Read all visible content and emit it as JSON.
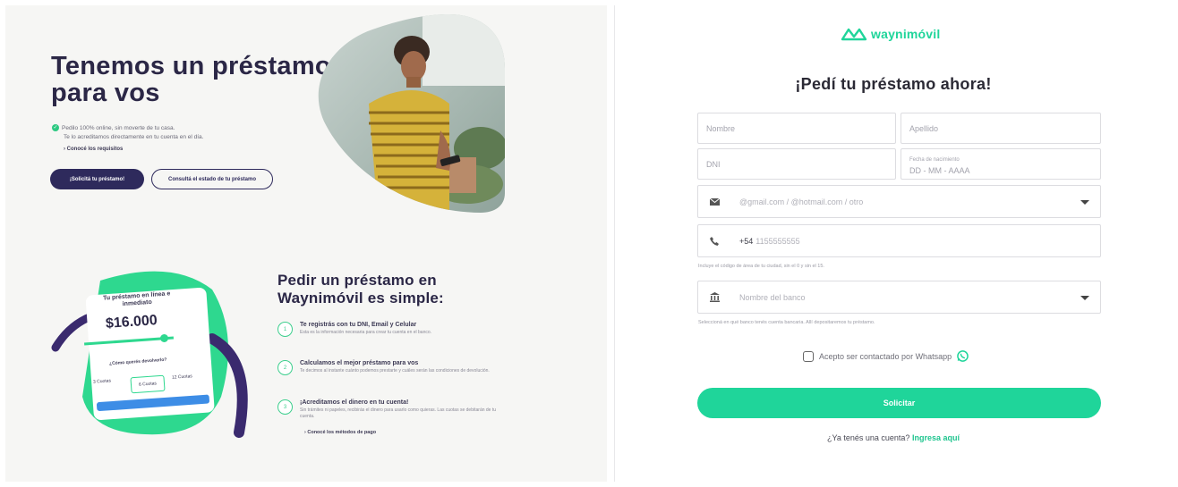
{
  "hero": {
    "title": "Tenemos un préstamo para vos",
    "bullet_1": "Pedilo 100% online, sin moverte de tu casa.",
    "bullet_2": "Te lo acreditamos directamente en tu cuenta en el día.",
    "requirements_link": "› Conocé los requisitos",
    "primary_button": "¡Solicitá tu préstamo!",
    "secondary_button": "Consultá el estado de tu préstamo"
  },
  "loan_card": {
    "heading": "Tu préstamo en línea e inmediato",
    "amount": "$16.000",
    "question": "¿Cómo querés devolverlo?",
    "options": [
      "3 Cuotas",
      "6 Cuotas",
      "12 Cuotas"
    ]
  },
  "steps": {
    "title": "Pedir un préstamo en Waynimóvil es simple:",
    "items": [
      {
        "num": "1",
        "title": "Te registrás con tu DNI, Email y Celular",
        "desc": "Esta es la información necesaria para crear tu cuenta en el banco."
      },
      {
        "num": "2",
        "title": "Calculamos el mejor préstamo para vos",
        "desc": "Te decimos al instante cuánto podemos prestarte y cuáles serán las condiciones de devolución."
      },
      {
        "num": "3",
        "title": "¡Acreditamos el dinero en tu cuenta!",
        "desc": "Sin trámites ni papeles, recibirás el dinero para usarlo como quieras. Las cuotas se debitarán de tu cuenta."
      }
    ],
    "payment_link": "› Conocé los métodos de pago"
  },
  "form": {
    "brand": "waynimóvil",
    "title": "¡Pedí tu préstamo ahora!",
    "nombre_placeholder": "Nombre",
    "apellido_placeholder": "Apellido",
    "dni_placeholder": "DNI",
    "birth_label": "Fecha de nacimiento",
    "birth_placeholder": "DD - MM - AAAA",
    "email_placeholder": "@gmail.com / @hotmail.com / otro",
    "phone_prefix": "+54",
    "phone_placeholder": "1155555555",
    "phone_hint": "Incluye el código de área de tu ciudad, sin el 0 y sin el 15.",
    "bank_placeholder": "Nombre del banco",
    "bank_hint": "Seleccioná en qué banco tenés cuenta bancaria. Allí depositaremos tu préstamo.",
    "whatsapp_label": "Acepto ser contactado por Whatsapp",
    "submit_label": "Solicitar",
    "login_prompt": "¿Ya tenés una cuenta?",
    "login_link": "Ingresa aquí"
  },
  "colors": {
    "brand_green": "#1fd59a",
    "navy": "#2e2a5c",
    "purple_dark": "#3a2a6e"
  }
}
